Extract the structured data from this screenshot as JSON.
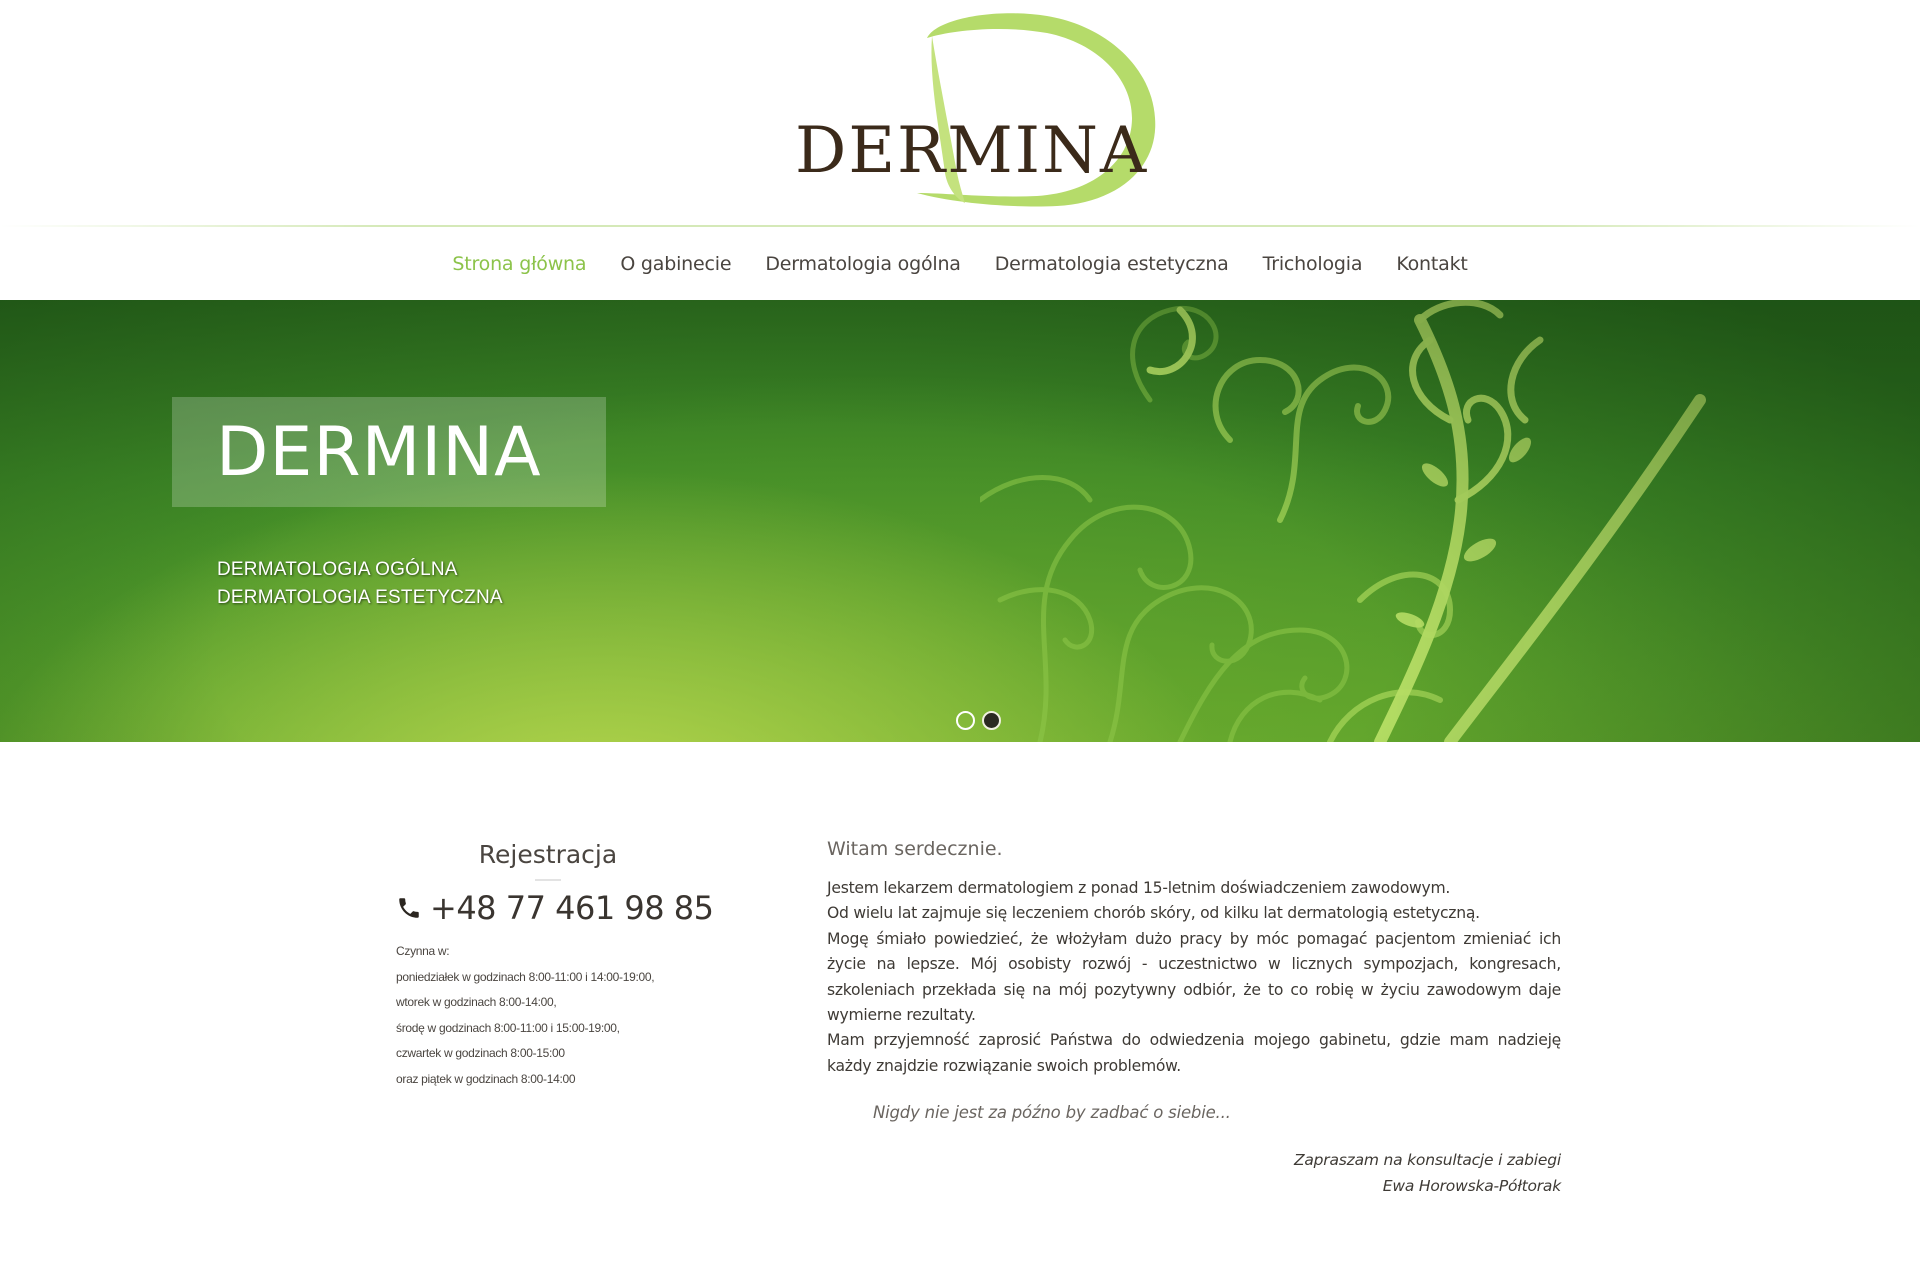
{
  "brand": {
    "logo_text": "DERMINA",
    "accent": "#8cc34a",
    "logo_color": "#3b2a1a"
  },
  "nav": {
    "items": [
      {
        "label": "Strona główna",
        "active": true
      },
      {
        "label": "O gabinecie",
        "active": false
      },
      {
        "label": "Dermatologia ogólna",
        "active": false
      },
      {
        "label": "Dermatologia estetyczna",
        "active": false
      },
      {
        "label": "Trichologia",
        "active": false
      },
      {
        "label": "Kontakt",
        "active": false
      }
    ]
  },
  "hero": {
    "title": "DERMINA",
    "subtitle_lines": [
      "DERMATOLOGIA OGÓLNA",
      "DERMATOLOGIA ESTETYCZNA"
    ],
    "slides": {
      "count": 2,
      "active_index": 2
    }
  },
  "registration": {
    "title": "Rejestracja",
    "phone": "+48 77 461 98 85",
    "hours": [
      "Czynna w:",
      "poniedziałek w godzinach 8:00-11:00 i 14:00-19:00,",
      "wtorek w godzinach 8:00-14:00,",
      "środę w godzinach 8:00-11:00 i 15:00-19:00,",
      "czwartek w godzinach 8:00-15:00",
      "oraz piątek w godzinach 8:00-14:00"
    ]
  },
  "content": {
    "greeting": "Witam serdecznie.",
    "paragraphs": [
      "Jestem lekarzem dermatologiem z ponad 15-letnim doświadczeniem zawodowym.",
      "Od wielu lat zajmuje się leczeniem chorób skóry, od kilku lat dermatologią estetyczną.",
      "Mogę śmiało powiedzieć, że włożyłam dużo pracy by móc pomagać pacjentom zmieniać ich życie na lepsze. Mój osobisty rozwój - uczestnictwo w licznych sympozjach, kongresach, szkoleniach przekłada się na mój pozytywny odbiór, że to co robię w życiu zawodowym daje wymierne rezultaty.",
      "Mam przyjemność zaprosić Państwa do odwiedzenia mojego gabinetu, gdzie mam nadzieję każdy znajdzie rozwiązanie swoich problemów."
    ],
    "quote": "Nigdy nie jest za późno by zadbać o siebie...",
    "signature_lines": [
      "Zapraszam na konsultacje i zabiegi",
      "Ewa Horowska-Półtorak"
    ]
  }
}
